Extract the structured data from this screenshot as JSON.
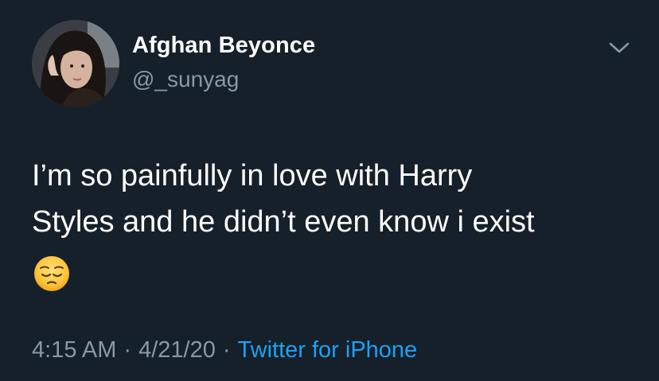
{
  "user": {
    "display_name": "Afghan Beyonce",
    "handle": "@_sunyag"
  },
  "tweet": {
    "text_lines": [
      "I’m so painfully in love with Harry",
      "Styles and he didn’t even know i exist"
    ],
    "emoji": "pensive-face"
  },
  "meta": {
    "time": "4:15 AM",
    "separator": "·",
    "date": "4/21/20",
    "source": "Twitter for iPhone"
  },
  "colors": {
    "background": "#15202b",
    "primary_text": "#ffffff",
    "secondary_text": "#8899a6",
    "link": "#1da1f2"
  },
  "icons": {
    "menu": "chevron-down-icon"
  }
}
